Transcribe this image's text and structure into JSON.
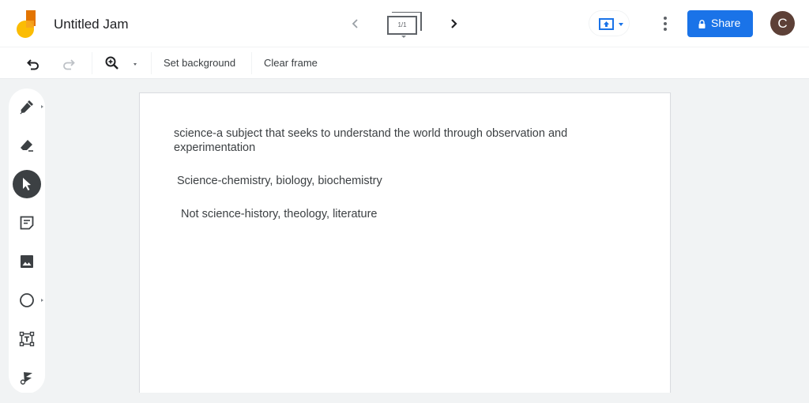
{
  "header": {
    "app_title": "Untitled Jam",
    "logo_icon": "jamboard-logo-icon",
    "frame_indicator": "1/1",
    "prev_frame_icon": "chevron-left-icon",
    "next_frame_icon": "chevron-right-icon",
    "present_icon": "cast-present-icon",
    "more_icon": "more-vert-icon",
    "share_label": "Share",
    "share_icon": "lock-icon",
    "avatar_initial": "C",
    "colors": {
      "share_bg": "#1a73e8",
      "avatar_bg": "#5d4037",
      "logo_yellow": "#fbbc04",
      "logo_orange": "#e37400"
    }
  },
  "toolbar": {
    "undo_icon": "undo-icon",
    "redo_icon": "redo-icon",
    "zoom_icon": "zoom-in-icon",
    "set_background_label": "Set background",
    "clear_frame_label": "Clear frame"
  },
  "tools": [
    {
      "name": "pen",
      "icon": "pen-icon",
      "has_submenu": true,
      "active": false
    },
    {
      "name": "eraser",
      "icon": "eraser-icon",
      "has_submenu": false,
      "active": false
    },
    {
      "name": "select",
      "icon": "cursor-arrow-icon",
      "has_submenu": false,
      "active": true
    },
    {
      "name": "sticky-note",
      "icon": "sticky-note-icon",
      "has_submenu": false,
      "active": false
    },
    {
      "name": "image",
      "icon": "image-icon",
      "has_submenu": false,
      "active": false
    },
    {
      "name": "shape",
      "icon": "circle-shape-icon",
      "has_submenu": true,
      "active": false
    },
    {
      "name": "text-box",
      "icon": "text-box-icon",
      "has_submenu": false,
      "active": false
    },
    {
      "name": "laser",
      "icon": "laser-pointer-icon",
      "has_submenu": false,
      "active": false
    }
  ],
  "canvas": {
    "notes": [
      {
        "text": "science-a subject that seeks to understand the world through observation and experimentation"
      },
      {
        "text": "Science-chemistry, biology, biochemistry"
      },
      {
        "text": "Not science-history, theology, literature"
      }
    ]
  }
}
